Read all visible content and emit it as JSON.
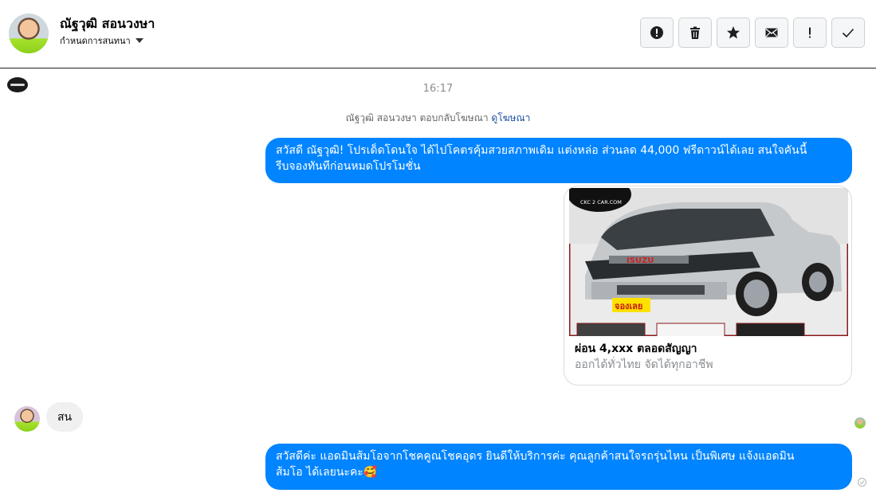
{
  "header": {
    "contact_name": "ณัฐวุฒิ สอนวงษา",
    "assign_label": "กำหนดการสนทนา",
    "toolbar": [
      {
        "name": "spam-icon",
        "label": "!"
      },
      {
        "name": "trash-icon",
        "label": ""
      },
      {
        "name": "star-icon",
        "label": ""
      },
      {
        "name": "envelope-icon",
        "label": ""
      },
      {
        "name": "exclamation-icon",
        "label": "!"
      },
      {
        "name": "check-icon",
        "label": ""
      }
    ]
  },
  "thread": {
    "timestamp": "16:17",
    "system_text": "ณัฐวุฒิ สอนวงษา ตอบกลับโฆษณา",
    "system_link": "ดูโฆษณา",
    "messages": {
      "first_outgoing_line1": "สวัสดี ณัฐวุฒิ! โปรเด็ดโดนใจ ได้ไปโคตรคุ้มสวยสภาพเดิม แต่งหล่อ  ส่วนลด 44,000 ฟรีดาวน์ได้เลย  สนใจคันนี้",
      "first_outgoing_line2": "รีบจองทันทีก่อนหมดโปรโมชั่น",
      "incoming": "สน",
      "second_outgoing_line1": "สวัสดีค่ะ แอดมินส้มโอจากโชคคูณโชคอุดร ยินดีให้บริการค่ะ   คุณลูกค้าสนใจรถรุ่นไหน เป็นพิเศษ แจ้งแอดมิน",
      "second_outgoing_line2": "ส้มโอ ได้เลยนะคะ🥰"
    },
    "card": {
      "image_badge": "จองเลย",
      "image_logo": "CKC 2 CAR.COM",
      "image_brand": "ISUZU",
      "title": "ผ่อน 4,xxx ตลอดสัญญา",
      "subtitle": "ออกได้ทั่วไทย จัดได้ทุกอาชีพ"
    }
  },
  "colors": {
    "outgoing_bubble": "#0084ff",
    "incoming_bubble": "#f0f0f0",
    "link": "#1c4ea3"
  }
}
